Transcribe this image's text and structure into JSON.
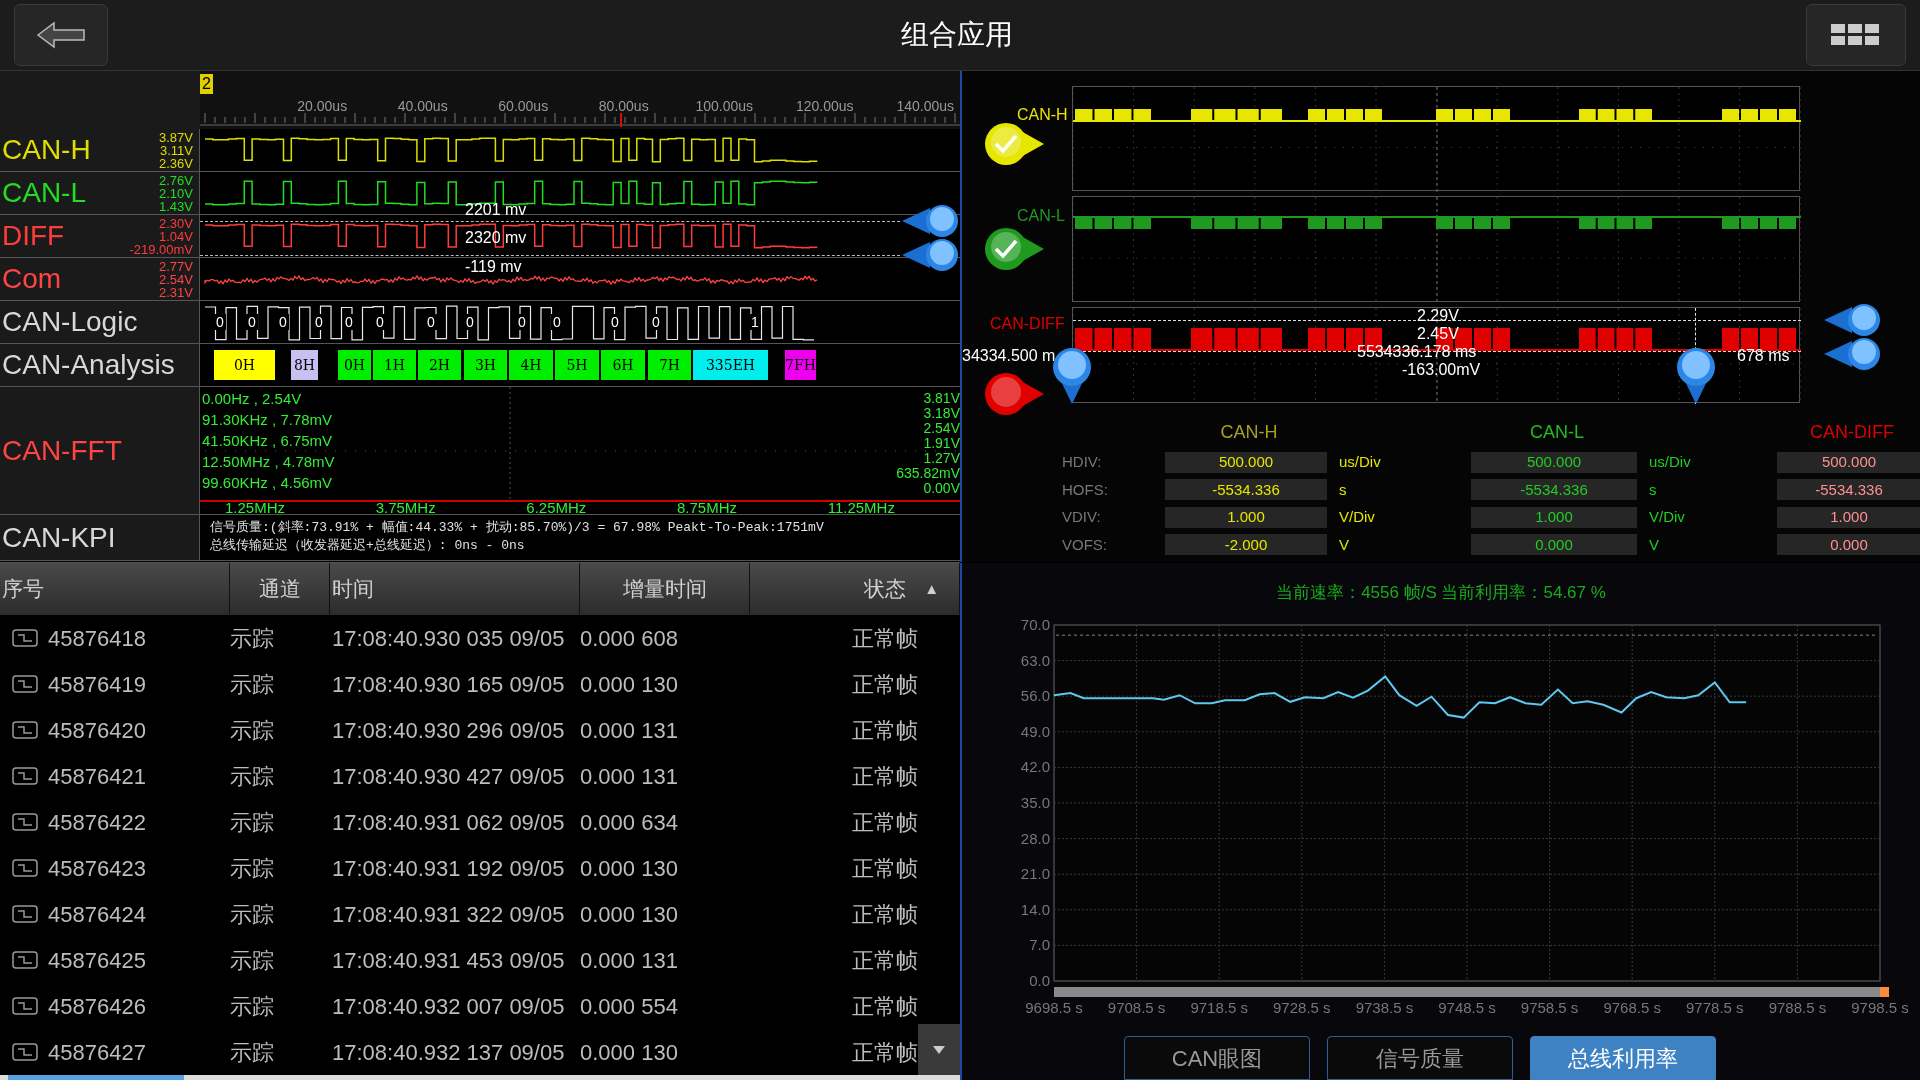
{
  "header": {
    "title": "组合应用"
  },
  "ruler": {
    "marker": "2",
    "ticks": [
      "20.00us",
      "40.00us",
      "60.00us",
      "80.00us",
      "100.00us",
      "120.00us",
      "140.00us"
    ]
  },
  "channels": [
    {
      "name": "CAN-H",
      "kind": "analog",
      "color": "#dede00",
      "scale": [
        "3.87V",
        "3.11V",
        "2.36V"
      ]
    },
    {
      "name": "CAN-L",
      "kind": "analog",
      "color": "#22dd22",
      "scale": [
        "2.76V",
        "2.10V",
        "1.43V"
      ]
    },
    {
      "name": "DIFF",
      "kind": "analog",
      "color": "#ff3b3b",
      "scale": [
        "2.30V",
        "1.04V",
        "-219.00mV"
      ]
    },
    {
      "name": "Com",
      "kind": "noise",
      "color": "#ff4444",
      "scale": [
        "2.77V",
        "2.54V",
        "2.31V"
      ]
    },
    {
      "name": "CAN-Logic",
      "kind": "logic",
      "color": "#d8d8d8",
      "bits": [
        "0",
        "0",
        "0",
        "0",
        "0",
        "0",
        "0",
        "0",
        "0",
        "0",
        "0",
        "0",
        "1"
      ]
    },
    {
      "name": "CAN-Analysis",
      "kind": "frames",
      "color": "#d8d8d8",
      "segments": [
        {
          "label": "0H",
          "color": "#ffff00"
        },
        {
          "label": "8H",
          "color": "#c8c0f0"
        },
        {
          "label": "0H",
          "color": "#00ee00"
        },
        {
          "label": "1H",
          "color": "#00ee00"
        },
        {
          "label": "2H",
          "color": "#00ee00"
        },
        {
          "label": "3H",
          "color": "#00ee00"
        },
        {
          "label": "4H",
          "color": "#00ee00"
        },
        {
          "label": "5H",
          "color": "#00ee00"
        },
        {
          "label": "6H",
          "color": "#00ee00"
        },
        {
          "label": "7H",
          "color": "#00ee00"
        },
        {
          "label": "335EH",
          "color": "#00eeee"
        },
        {
          "label": "7FH",
          "color": "#ee00ee"
        }
      ]
    },
    {
      "name": "CAN-FFT",
      "kind": "fft",
      "color": "#ff4444",
      "peaks": [
        "0.00Hz , 2.54V",
        "91.30KHz , 7.78mV",
        "41.50KHz , 6.75mV",
        "12.50MHz , 4.78mV",
        "99.60KHz , 4.56mV"
      ],
      "scale": [
        "3.81V",
        "3.18V",
        "2.54V",
        "1.91V",
        "1.27V",
        "635.82mV",
        "0.00V"
      ],
      "freqs": [
        "1.25MHz",
        "3.75MHz",
        "6.25MHz",
        "8.75MHz",
        "11.25MHz"
      ]
    },
    {
      "name": "CAN-KPI",
      "kind": "kpi",
      "color": "#d8d8d8",
      "lines": [
        "信号质量:(斜率:73.91% + 幅值:44.33% + 扰动:85.70%)/3 = 67.98%  Peakt-To-Peak:1751mV",
        "总线传输延迟（收发器延迟+总线延迟）:  0ns - 0ns"
      ]
    }
  ],
  "cursor_readouts": [
    "2201 mv",
    "2320 mv",
    "-119 mv"
  ],
  "table": {
    "columns": [
      {
        "label": "序号"
      },
      {
        "label": "通道"
      },
      {
        "label": "时间"
      },
      {
        "label": "增量时间"
      },
      {
        "label": "状态",
        "sort_mark": "▲"
      }
    ],
    "rows": [
      [
        "45876418",
        "示踪",
        "17:08:40.930 035 09/05",
        "0.000 608",
        "正常帧"
      ],
      [
        "45876419",
        "示踪",
        "17:08:40.930 165 09/05",
        "0.000 130",
        "正常帧"
      ],
      [
        "45876420",
        "示踪",
        "17:08:40.930 296 09/05",
        "0.000 131",
        "正常帧"
      ],
      [
        "45876421",
        "示踪",
        "17:08:40.930 427 09/05",
        "0.000 131",
        "正常帧"
      ],
      [
        "45876422",
        "示踪",
        "17:08:40.931 062 09/05",
        "0.000 634",
        "正常帧"
      ],
      [
        "45876423",
        "示踪",
        "17:08:40.931 192 09/05",
        "0.000 130",
        "正常帧"
      ],
      [
        "45876424",
        "示踪",
        "17:08:40.931 322 09/05",
        "0.000 130",
        "正常帧"
      ],
      [
        "45876425",
        "示踪",
        "17:08:40.931 453 09/05",
        "0.000 131",
        "正常帧"
      ],
      [
        "45876426",
        "示踪",
        "17:08:40.932 007 09/05",
        "0.000 554",
        "正常帧"
      ],
      [
        "45876427",
        "示踪",
        "17:08:40.932 137 09/05",
        "0.000 130",
        "正常帧"
      ]
    ]
  },
  "eye": {
    "channels": [
      {
        "name": "CAN-H",
        "color": "#e6e600",
        "ok": true
      },
      {
        "name": "CAN-L",
        "color": "#1f9a1f",
        "ok": true
      },
      {
        "name": "CAN-DIFF",
        "color": "#e00000",
        "ok": false
      }
    ],
    "readouts": {
      "top": "2.29V",
      "middle": "2.45V",
      "time": "5534336.178 ms",
      "bottom": "-163.00mV",
      "left": "34334.500 m",
      "right": "678 ms"
    }
  },
  "params": {
    "headers": [
      "CAN-H",
      "CAN-L",
      "CAN-DIFF"
    ],
    "rows": [
      {
        "label": "HDIV:",
        "values": [
          "500.000",
          "500.000",
          "500.000"
        ],
        "units": [
          "us/Div",
          "us/Div"
        ]
      },
      {
        "label": "HOFS:",
        "values": [
          "-5534.336",
          "-5534.336",
          "-5534.336"
        ],
        "units": [
          "s",
          "s"
        ]
      },
      {
        "label": "VDIV:",
        "values": [
          "1.000",
          "1.000",
          "1.000"
        ],
        "units": [
          "V/Div",
          "V/Div"
        ]
      },
      {
        "label": "VOFS:",
        "values": [
          "-2.000",
          "0.000",
          "0.000"
        ],
        "units": [
          "V",
          "V"
        ]
      }
    ]
  },
  "utilization": {
    "summary": "当前速率：4556 帧/S 当前利用率：54.67 %",
    "chart_data": {
      "type": "line",
      "xlim": [
        9698.5,
        9798.5
      ],
      "ylim": [
        0,
        70
      ],
      "xticks": [
        {
          "value": 9698.5,
          "label": "9698.5 s"
        },
        {
          "value": 9708.5,
          "label": "9708.5 s"
        },
        {
          "value": 9718.5,
          "label": "9718.5 s"
        },
        {
          "value": 9728.5,
          "label": "9728.5 s"
        },
        {
          "value": 9738.5,
          "label": "9738.5 s"
        },
        {
          "value": 9748.5,
          "label": "9748.5 s"
        },
        {
          "value": 9758.5,
          "label": "9758.5 s"
        },
        {
          "value": 9768.5,
          "label": "9768.5 s"
        },
        {
          "value": 9778.5,
          "label": "9778.5 s"
        },
        {
          "value": 9788.5,
          "label": "9788.5 s"
        },
        {
          "value": 9798.5,
          "label": "9798.5 s"
        }
      ],
      "yticks": [
        {
          "value": 0,
          "label": "0.0"
        },
        {
          "value": 7,
          "label": "7.0"
        },
        {
          "value": 14,
          "label": "14.0"
        },
        {
          "value": 21,
          "label": "21.0"
        },
        {
          "value": 28,
          "label": "28.0"
        },
        {
          "value": 35,
          "label": "35.0"
        },
        {
          "value": 42,
          "label": "42.0"
        },
        {
          "value": 49,
          "label": "49.0"
        },
        {
          "value": 56,
          "label": "56.0"
        },
        {
          "value": 63,
          "label": "63.0"
        },
        {
          "value": 70,
          "label": "70.0"
        }
      ],
      "x": [
        9698.5,
        9700.5,
        9702.1,
        9704.3,
        9710.5,
        9711.8,
        9713.7,
        9715.6,
        9717.6,
        9719.2,
        9721.6,
        9723.4,
        9725.2,
        9727.1,
        9728.9,
        9731.1,
        9732.9,
        9734.7,
        9736.5,
        9738.6,
        9740.3,
        9742.4,
        9744.2,
        9746.2,
        9748.1,
        9750.0,
        9751.9,
        9753.7,
        9755.6,
        9757.5,
        9759.5,
        9761.3,
        9763.1,
        9765.0,
        9767.2,
        9769.0,
        9770.8,
        9772.6,
        9774.8,
        9776.5,
        9778.5,
        9780.3,
        9782.3
      ],
      "grid": true,
      "series": [
        {
          "color": "#5ec8f0",
          "values": [
            56.2,
            56.6,
            55.6,
            55.6,
            55.6,
            55.3,
            56.2,
            54.6,
            54.6,
            55.2,
            55.2,
            56.4,
            56.6,
            54.9,
            55.8,
            55.6,
            56.8,
            55.7,
            57.1,
            59.9,
            56.2,
            54.1,
            55.9,
            52.3,
            51.8,
            54.8,
            54.6,
            55.8,
            54.6,
            54.3,
            57.3,
            54.6,
            55.0,
            54.3,
            52.8,
            55.6,
            56.8,
            55.8,
            55.6,
            56.2,
            58.7,
            54.8,
            54.8
          ]
        }
      ],
      "ref_lines": [
        {
          "axis": "y",
          "value": 68
        }
      ]
    },
    "tabs": [
      {
        "label": "CAN眼图",
        "selected": false
      },
      {
        "label": "信号质量",
        "selected": false
      },
      {
        "label": "总线利用率",
        "selected": true
      }
    ]
  }
}
